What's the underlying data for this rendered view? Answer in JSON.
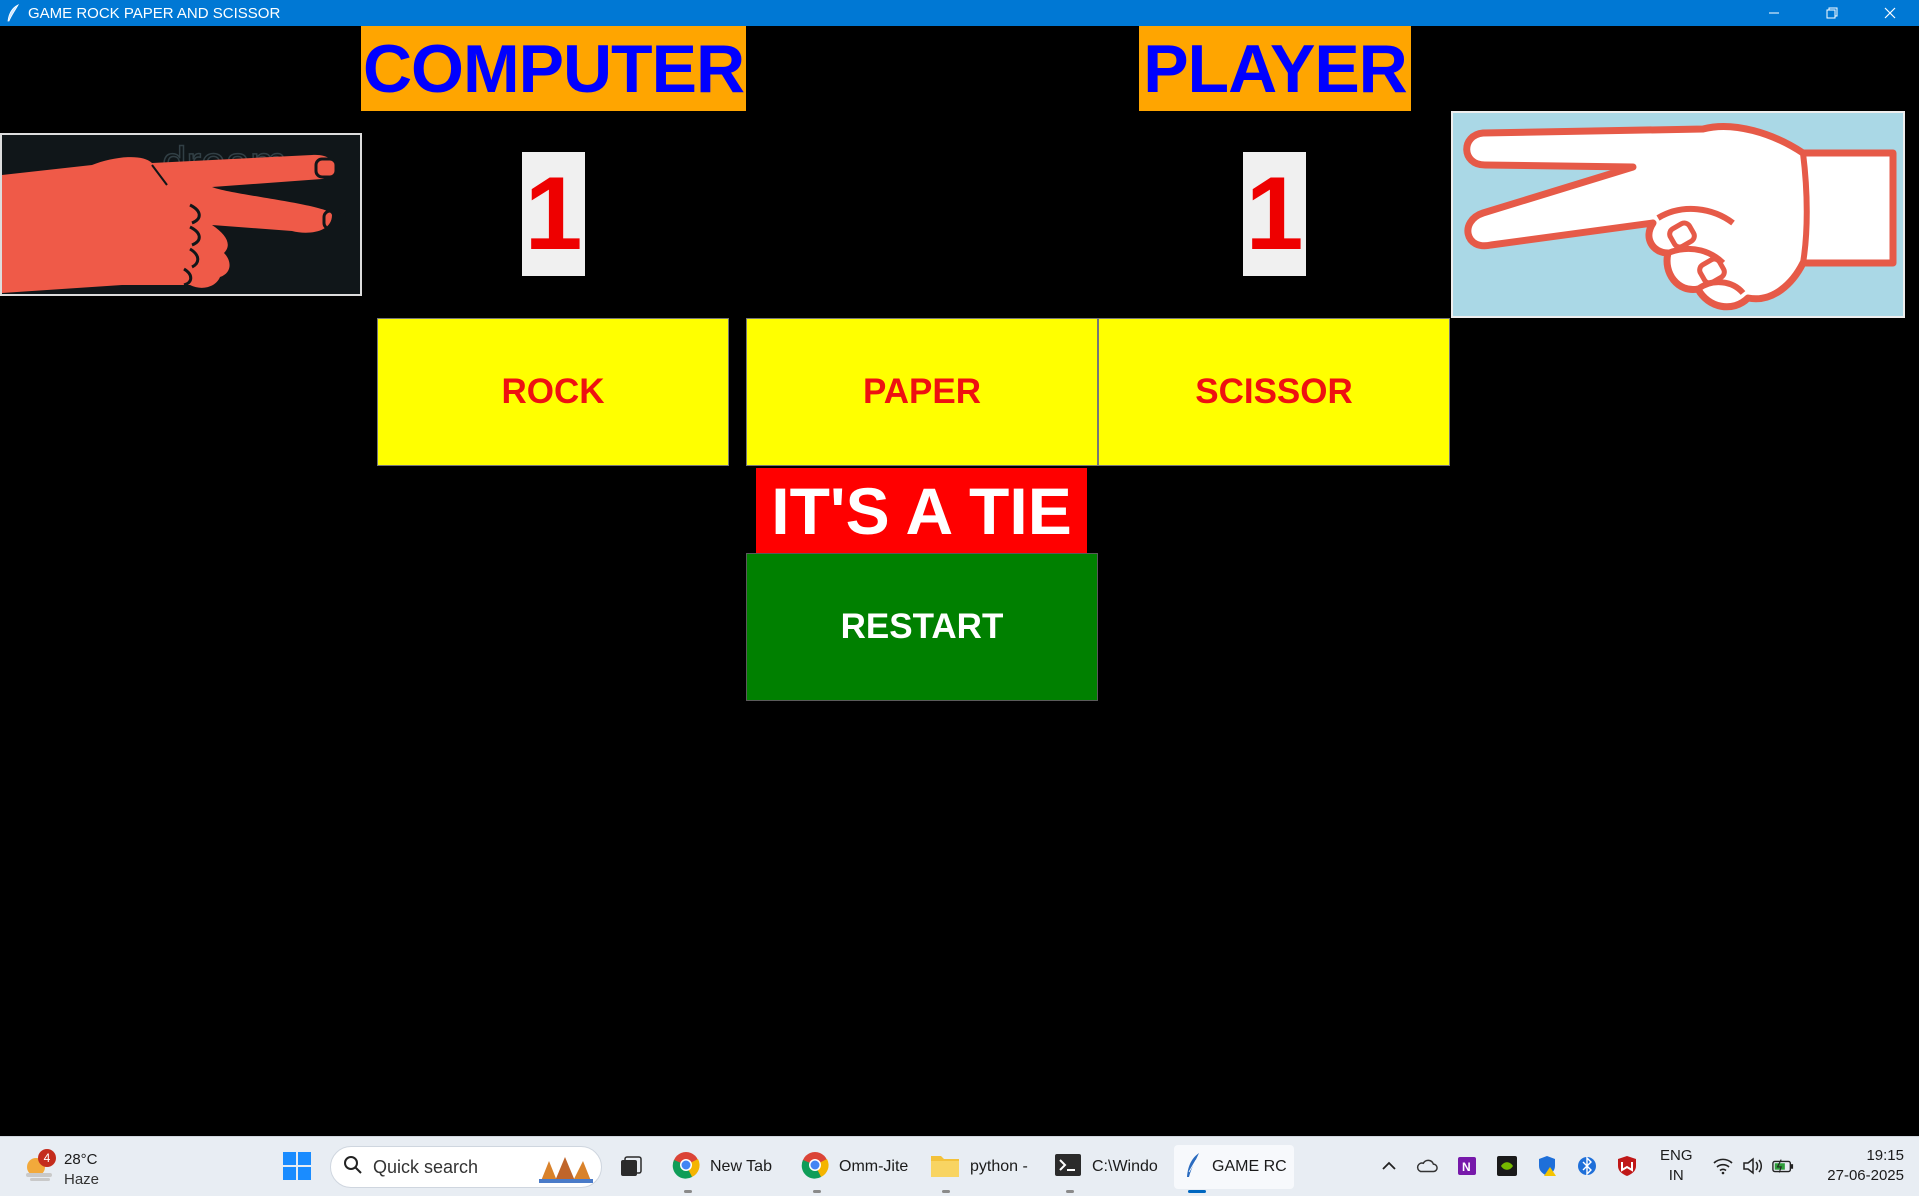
{
  "window": {
    "title": "GAME ROCK PAPER AND SCISSOR",
    "icon": "feather-icon",
    "controls": [
      "minimize-icon",
      "restore-icon",
      "close-icon"
    ]
  },
  "game": {
    "computer_label": "COMPUTER",
    "player_label": "PLAYER",
    "computer_score": "1",
    "player_score": "1",
    "computer_hand": "scissor-hand-image",
    "player_hand": "scissor-hand-image",
    "buttons": {
      "rock": "ROCK",
      "paper": "PAPER",
      "scissor": "SCISSOR"
    },
    "result": "IT'S A TIE",
    "restart": "RESTART",
    "colors": {
      "background": "#000000",
      "heading_bg": "#ffa500",
      "heading_text": "#0000ff",
      "choice_bg": "#ffff00",
      "choice_text": "#ee1111",
      "result_bg": "#ff0000",
      "restart_bg": "#008000"
    }
  },
  "taskbar": {
    "weather": {
      "badge": "4",
      "temp": "28°C",
      "condition": "Haze"
    },
    "search_placeholder": "Quick search",
    "apps": [
      {
        "label": "New Tab",
        "icon": "chrome-icon"
      },
      {
        "label": "Omm-Jite",
        "icon": "chrome-icon"
      },
      {
        "label": "python -",
        "icon": "folder-icon"
      },
      {
        "label": "C:\\Windo",
        "icon": "terminal-icon"
      },
      {
        "label": "GAME RC",
        "icon": "feather-icon"
      }
    ],
    "language": {
      "line1": "ENG",
      "line2": "IN"
    },
    "time": "19:15",
    "date": "27-06-2025"
  }
}
